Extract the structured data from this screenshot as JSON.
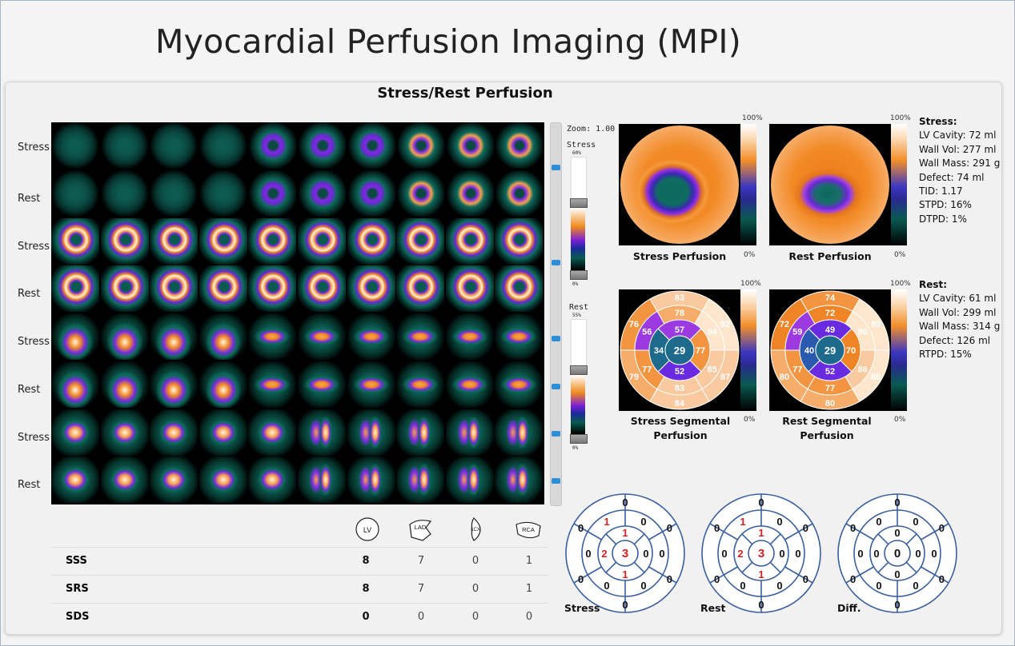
{
  "title": "Myocardial Perfusion Imaging (MPI)",
  "panel_title": "Stress/Rest Perfusion",
  "row_labels": [
    "Stress",
    "Rest",
    "Stress",
    "Rest",
    "Stress",
    "Rest",
    "Stress",
    "Rest"
  ],
  "scale": {
    "zoom_label": "Zoom: 1.00",
    "stress_label": "Stress",
    "stress_pct_top": "60%",
    "stress_pct_bottom": "0%",
    "rest_label": "Rest",
    "rest_pct_top": "55%",
    "rest_pct_bottom": "0%"
  },
  "maps": {
    "stress_perfusion_label": "Stress Perfusion",
    "rest_perfusion_label": "Rest Perfusion",
    "stress_segmental_label": "Stress Segmental Perfusion",
    "rest_segmental_label": "Rest Segmental Perfusion",
    "pct_top": "100%",
    "pct_bottom": "0%"
  },
  "stress_segments": {
    "apex": "29",
    "mid": [
      "57",
      "77",
      "52",
      "34"
    ],
    "base": [
      "78",
      "94",
      "85",
      "83",
      "77",
      "56"
    ],
    "outer_base": [
      "83",
      "92",
      "87",
      "84",
      "79",
      "76"
    ]
  },
  "rest_segments": {
    "apex": "29",
    "mid": [
      "49",
      "70",
      "52",
      "40"
    ],
    "base": [
      "72",
      "90",
      "86",
      "77",
      "77",
      "59"
    ],
    "outer_base": [
      "74",
      "89",
      "88",
      "80",
      "80",
      "72"
    ]
  },
  "stress_stats": {
    "header": "Stress:",
    "lines": [
      "LV Cavity: 72 ml",
      "Wall Vol: 277 ml",
      "Wall Mass: 291 g",
      "Defect: 74 ml",
      "TID: 1.17",
      "STPD: 16%",
      "DTPD: 1%"
    ]
  },
  "rest_stats": {
    "header": "Rest:",
    "lines": [
      "LV Cavity: 61 ml",
      "Wall Vol: 299 ml",
      "Wall Mass: 314 g",
      "Defect: 126 ml",
      "RTPD: 15%"
    ]
  },
  "score_table": {
    "columns": [
      "LV",
      "LAD",
      "LCX",
      "RCA"
    ],
    "rows": [
      {
        "label": "SSS",
        "values": [
          "8",
          "7",
          "0",
          "1"
        ]
      },
      {
        "label": "SRS",
        "values": [
          "8",
          "7",
          "0",
          "1"
        ]
      },
      {
        "label": "SDS",
        "values": [
          "0",
          "0",
          "0",
          "0"
        ]
      }
    ]
  },
  "bullseyes": [
    {
      "label": "Stress",
      "apex": "3",
      "mid": [
        "1",
        "0",
        "1",
        "2"
      ],
      "base": [
        "0",
        "0",
        "0",
        "0",
        "0",
        "1"
      ],
      "outer": [
        "0",
        "0",
        "0",
        "0",
        "0",
        "0"
      ]
    },
    {
      "label": "Rest",
      "apex": "3",
      "mid": [
        "1",
        "0",
        "1",
        "2"
      ],
      "base": [
        "0",
        "0",
        "0",
        "0",
        "0",
        "1"
      ],
      "outer": [
        "0",
        "0",
        "0",
        "0",
        "0",
        "0"
      ]
    },
    {
      "label": "Diff.",
      "apex": "0",
      "mid": [
        "0",
        "0",
        "0",
        "0"
      ],
      "base": [
        "0",
        "0",
        "0",
        "0",
        "0",
        "0"
      ],
      "outer": [
        "0",
        "0",
        "0",
        "0",
        "0",
        "0"
      ]
    }
  ],
  "colors": {
    "accent": "#2d8fd8",
    "bullseye_line": "#3a5fa0",
    "abnormal_score": "#d42020"
  }
}
